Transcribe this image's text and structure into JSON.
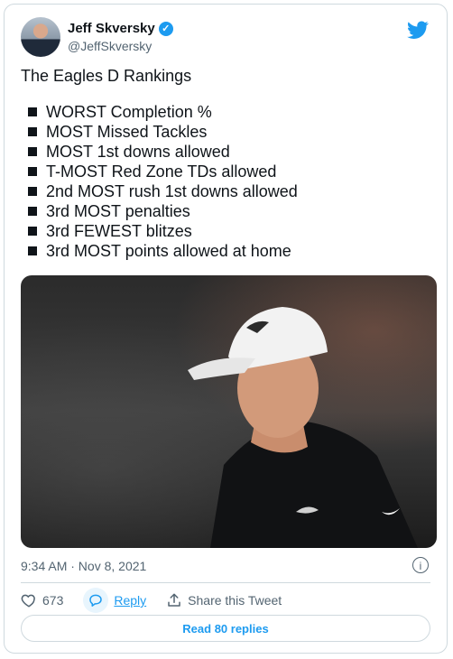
{
  "author": {
    "name": "Jeff Skversky",
    "handle": "@JeffSkversky"
  },
  "tweet": {
    "heading": "The Eagles D Rankings",
    "items": [
      "WORST Completion %",
      "MOST Missed Tackles",
      "MOST 1st downs allowed",
      "T-MOST Red Zone TDs allowed",
      "2nd MOST rush 1st downs allowed",
      "3rd MOST penalties",
      "3rd FEWEST blitzes",
      "3rd MOST points allowed at home"
    ]
  },
  "meta": {
    "timestamp": "9:34 AM · Nov 8, 2021"
  },
  "actions": {
    "like_count": "673",
    "reply_label": "Reply",
    "share_label": "Share this Tweet"
  },
  "footer": {
    "read_replies_label": "Read 80 replies"
  },
  "colors": {
    "accent": "#1d9bf0",
    "text": "#0f1419",
    "muted": "#536471",
    "border": "#cfd9de"
  }
}
